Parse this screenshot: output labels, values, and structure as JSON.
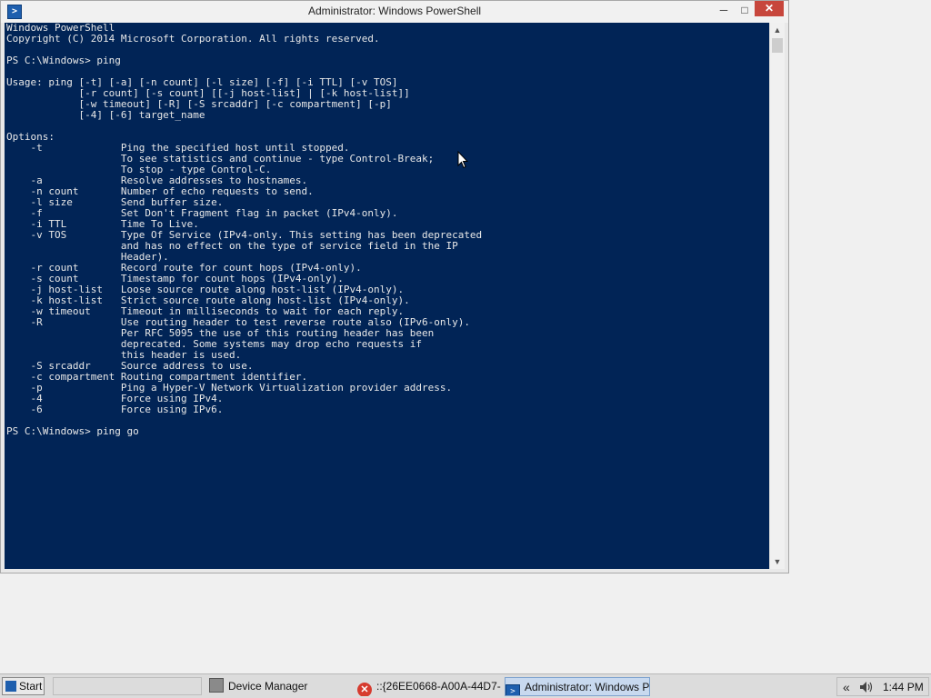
{
  "window": {
    "title": "Administrator: Windows PowerShell",
    "controls": {
      "minimize": "─",
      "maximize": "□",
      "close": "✕"
    }
  },
  "console": {
    "background": "#012456",
    "foreground": "#e8e8e8",
    "lines": [
      "Windows PowerShell",
      "Copyright (C) 2014 Microsoft Corporation. All rights reserved.",
      "",
      "PS C:\\Windows> ping",
      "",
      "Usage: ping [-t] [-a] [-n count] [-l size] [-f] [-i TTL] [-v TOS]",
      "            [-r count] [-s count] [[-j host-list] | [-k host-list]]",
      "            [-w timeout] [-R] [-S srcaddr] [-c compartment] [-p]",
      "            [-4] [-6] target_name",
      "",
      "Options:",
      "    -t             Ping the specified host until stopped.",
      "                   To see statistics and continue - type Control-Break;",
      "                   To stop - type Control-C.",
      "    -a             Resolve addresses to hostnames.",
      "    -n count       Number of echo requests to send.",
      "    -l size        Send buffer size.",
      "    -f             Set Don't Fragment flag in packet (IPv4-only).",
      "    -i TTL         Time To Live.",
      "    -v TOS         Type Of Service (IPv4-only. This setting has been deprecated",
      "                   and has no effect on the type of service field in the IP",
      "                   Header).",
      "    -r count       Record route for count hops (IPv4-only).",
      "    -s count       Timestamp for count hops (IPv4-only).",
      "    -j host-list   Loose source route along host-list (IPv4-only).",
      "    -k host-list   Strict source route along host-list (IPv4-only).",
      "    -w timeout     Timeout in milliseconds to wait for each reply.",
      "    -R             Use routing header to test reverse route also (IPv6-only).",
      "                   Per RFC 5095 the use of this routing header has been",
      "                   deprecated. Some systems may drop echo requests if",
      "                   this header is used.",
      "    -S srcaddr     Source address to use.",
      "    -c compartment Routing compartment identifier.",
      "    -p             Ping a Hyper-V Network Virtualization provider address.",
      "    -4             Force using IPv4.",
      "    -6             Force using IPv6.",
      "",
      "PS C:\\Windows> ping go"
    ]
  },
  "taskbar": {
    "start_label": "Start",
    "tasks": [
      {
        "label": "Device Manager",
        "icon": "device-manager-icon",
        "active": false
      },
      {
        "label": "::{26EE0668-A00A-44D7-...",
        "icon": "error-icon",
        "active": false
      },
      {
        "label": "Administrator: Windows P...",
        "icon": "powershell-icon",
        "active": true
      }
    ],
    "tray": {
      "chevron": "«",
      "clock": "1:44 PM"
    }
  }
}
